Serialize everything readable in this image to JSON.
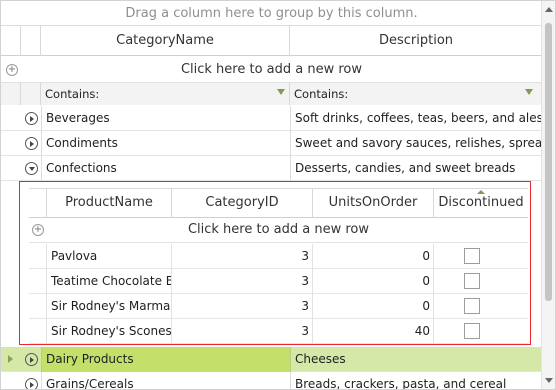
{
  "group_panel": {
    "text": "Drag a column here to group by this column."
  },
  "columns": {
    "category_name": "CategoryName",
    "description": "Description"
  },
  "new_row": {
    "label": "Click here to add a new row"
  },
  "filter": {
    "category_name": "Contains:",
    "description": "Contains:"
  },
  "categories": [
    {
      "name": "Beverages",
      "description": "Soft drinks, coffees, teas, beers, and ales"
    },
    {
      "name": "Condiments",
      "description": "Sweet and savory sauces, relishes, spreads,..."
    },
    {
      "name": "Confections",
      "description": "Desserts, candies, and sweet breads"
    },
    {
      "name": "Dairy Products",
      "description": "Cheeses"
    },
    {
      "name": "Grains/Cereals",
      "description": "Breads, crackers, pasta, and cereal"
    }
  ],
  "detail": {
    "columns": {
      "product_name": "ProductName",
      "category_id": "CategoryID",
      "units_on_order": "UnitsOnOrder",
      "discontinued": "Discontinued"
    },
    "new_row": "Click here to add a new row",
    "rows": [
      {
        "product_name": "Pavlova",
        "category_id": "3",
        "units_on_order": "0",
        "discontinued": false
      },
      {
        "product_name": "Teatime Chocolate B...",
        "category_id": "3",
        "units_on_order": "0",
        "discontinued": false
      },
      {
        "product_name": "Sir Rodney's Marma...",
        "category_id": "3",
        "units_on_order": "0",
        "discontinued": false
      },
      {
        "product_name": "Sir Rodney's Scones",
        "category_id": "3",
        "units_on_order": "40",
        "discontinued": false
      }
    ]
  },
  "colors": {
    "selected_row": "#d6e8a8",
    "selected_cell": "#c4e06a",
    "detail_border": "#e8262b",
    "filter_icon": "#7f9a55"
  },
  "icons": {
    "add_row": "plus-circle-icon",
    "expand": "expand-arrow-icon",
    "collapse": "collapse-arrow-icon",
    "filter": "filter-icon",
    "sort": "sort-ascending-icon",
    "current_row": "current-row-indicator-icon"
  }
}
